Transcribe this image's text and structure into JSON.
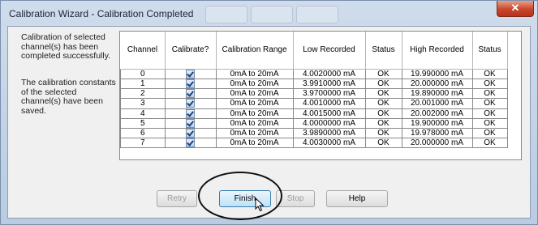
{
  "window": {
    "title": "Calibration Wizard - Calibration Completed"
  },
  "message": {
    "success": "Calibration of selected channel(s) has been completed successfully.",
    "saved": "The calibration constants of the selected channel(s) have been saved."
  },
  "table": {
    "headers": {
      "channel": "Channel",
      "calibrate": "Calibrate?",
      "range": "Calibration Range",
      "low": "Low Recorded",
      "status1": "Status",
      "high": "High Recorded",
      "status2": "Status"
    },
    "rows": [
      {
        "channel": "0",
        "calibrate": true,
        "range": "0mA to 20mA",
        "low": "4.0020000 mA",
        "status1": "OK",
        "high": "19.990000 mA",
        "status2": "OK"
      },
      {
        "channel": "1",
        "calibrate": true,
        "range": "0mA to 20mA",
        "low": "3.9910000 mA",
        "status1": "OK",
        "high": "20.000000 mA",
        "status2": "OK"
      },
      {
        "channel": "2",
        "calibrate": true,
        "range": "0mA to 20mA",
        "low": "3.9700000 mA",
        "status1": "OK",
        "high": "19.890000 mA",
        "status2": "OK"
      },
      {
        "channel": "3",
        "calibrate": true,
        "range": "0mA to 20mA",
        "low": "4.0010000 mA",
        "status1": "OK",
        "high": "20.001000 mA",
        "status2": "OK"
      },
      {
        "channel": "4",
        "calibrate": true,
        "range": "0mA to 20mA",
        "low": "4.0015000 mA",
        "status1": "OK",
        "high": "20.002000 mA",
        "status2": "OK"
      },
      {
        "channel": "5",
        "calibrate": true,
        "range": "0mA to 20mA",
        "low": "4.0000000 mA",
        "status1": "OK",
        "high": "19.900000 mA",
        "status2": "OK"
      },
      {
        "channel": "6",
        "calibrate": true,
        "range": "0mA to 20mA",
        "low": "3.9890000 mA",
        "status1": "OK",
        "high": "19.978000 mA",
        "status2": "OK"
      },
      {
        "channel": "7",
        "calibrate": true,
        "range": "0mA to 20mA",
        "low": "4.0030000 mA",
        "status1": "OK",
        "high": "20.000000 mA",
        "status2": "OK"
      }
    ]
  },
  "buttons": {
    "retry": "Retry",
    "finish": "Finish",
    "stop": "Stop",
    "help": "Help"
  },
  "icons": {
    "close": "close-icon",
    "checkbox": "checkmark-icon",
    "cursor": "mouse-pointer-icon"
  }
}
